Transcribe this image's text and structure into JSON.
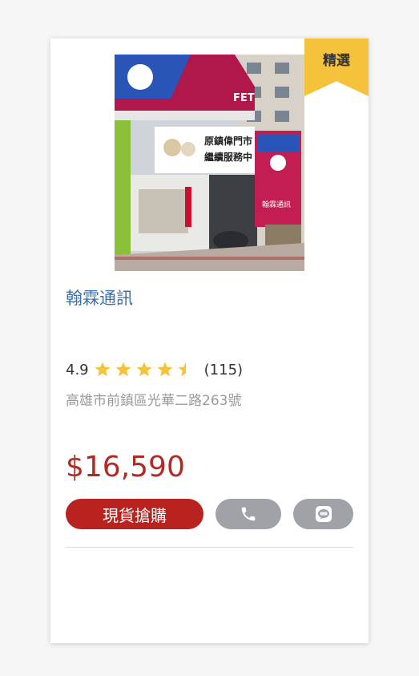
{
  "card": {
    "badge": "精選",
    "store_name": "翰霖通訊",
    "rating": {
      "score": "4.9",
      "stars": 4.5,
      "count": "(115)"
    },
    "address": "高雄市前鎮區光華二路263號",
    "price": "$16,590",
    "buy_label": "現貨搶購",
    "photo_signs": {
      "banner_line1": "原鎮偉門市",
      "banner_line2": "繼續服務中",
      "fet_logo": "FET",
      "pylon_text": "翰霖通訊"
    }
  },
  "icons": {
    "phone": "phone-icon",
    "line": "line-icon",
    "star": "star-icon"
  },
  "colors": {
    "badge": "#f5c33b",
    "store_name": "#3d6fa8",
    "price": "#b22a24",
    "buy_button": "#b8231f",
    "icon_button": "#9fa3a8",
    "star": "#f5c33b"
  }
}
